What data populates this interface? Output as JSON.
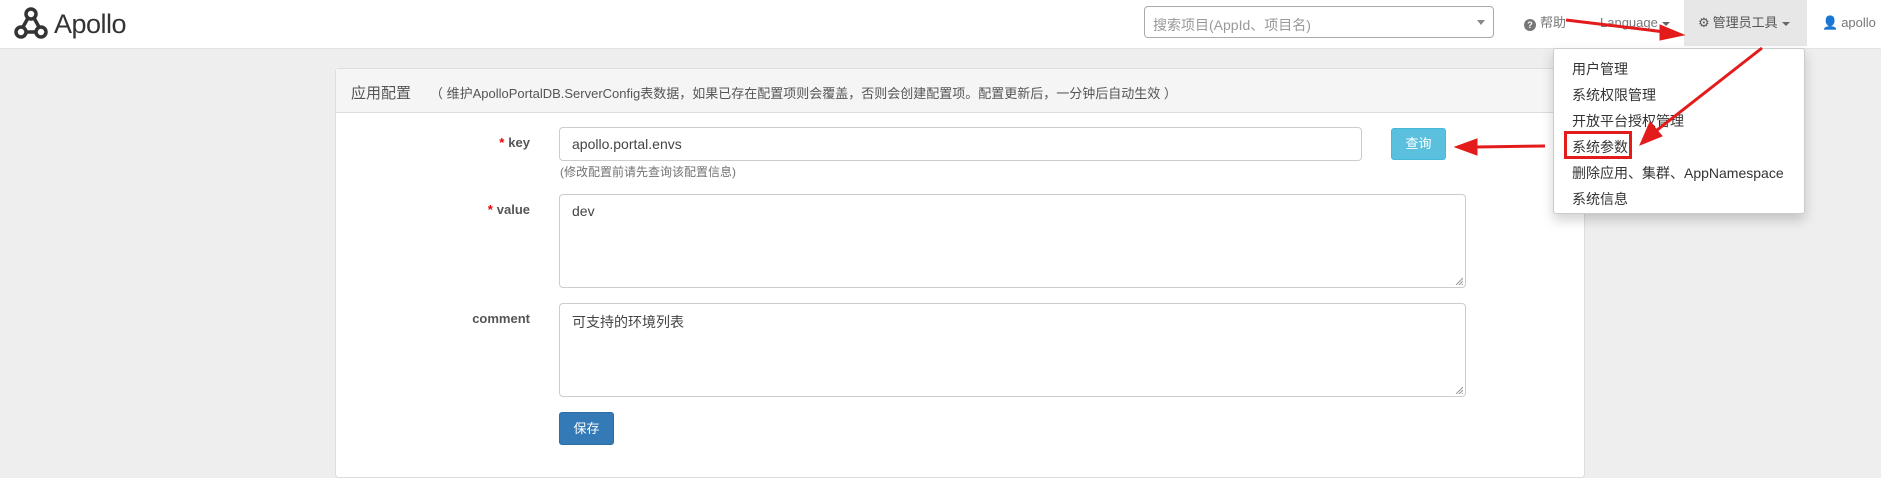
{
  "header": {
    "brand": "Apollo",
    "search_placeholder": "搜索项目(AppId、项目名)",
    "help_label": "帮助",
    "language_label": "Language",
    "admin_tools_label": "管理员工具",
    "user_label": "apollo"
  },
  "admin_menu": {
    "items": [
      "用户管理",
      "系统权限管理",
      "开放平台授权管理",
      "系统参数",
      "删除应用、集群、AppNamespace",
      "系统信息"
    ],
    "highlighted_item": "系统参数"
  },
  "panel": {
    "title": "应用配置",
    "description": "（ 维护ApolloPortalDB.ServerConfig表数据，如果已存在配置项则会覆盖，否则会创建配置项。配置更新后，一分钟后自动生效 ）"
  },
  "form": {
    "required_mark": "*",
    "key_label": "key",
    "key_value": "apollo.portal.envs",
    "key_help": "(修改配置前请先查询该配置信息)",
    "query_button": "查询",
    "value_label": "value",
    "value_value": "dev",
    "comment_label": "comment",
    "comment_value": "可支持的环境列表",
    "save_button": "保存"
  },
  "colors": {
    "annotation_red": "#e41b1b",
    "info_button": "#5bc0de",
    "primary_button": "#337ab7"
  }
}
